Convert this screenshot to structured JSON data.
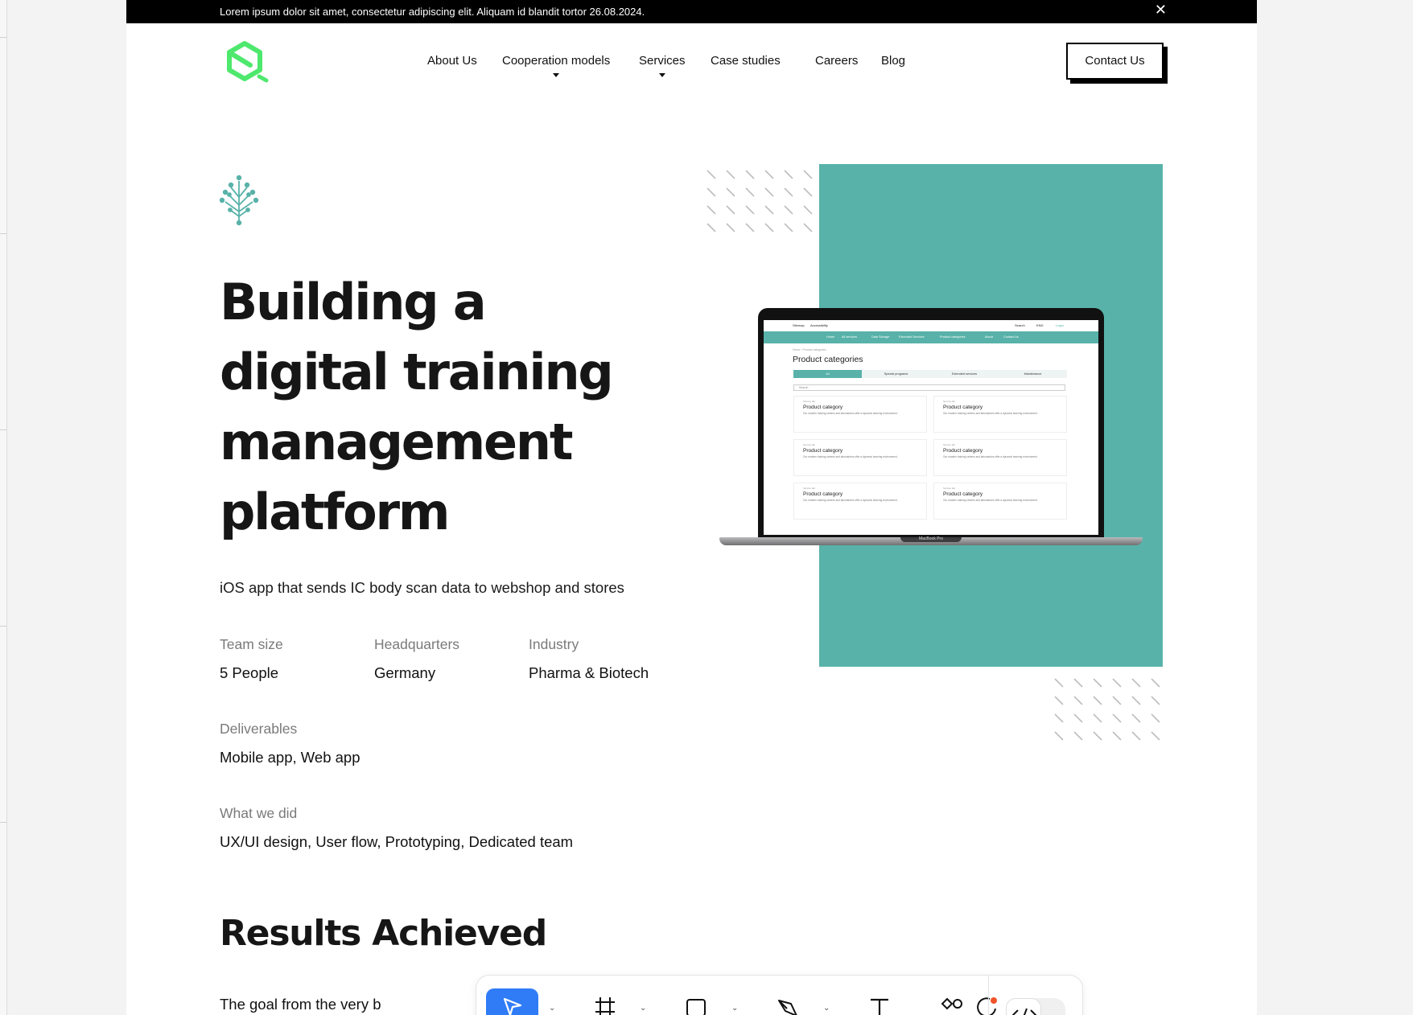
{
  "announcement": {
    "text": "Lorem ipsum dolor sit amet, consectetur adipiscing elit. Aliquam id blandit tortor 26.08.2024.",
    "close": "✕"
  },
  "nav": {
    "items": [
      {
        "label": "About Us",
        "dropdown": false
      },
      {
        "label": "Cooperation models",
        "dropdown": true
      },
      {
        "label": "Services",
        "dropdown": true
      },
      {
        "label": "Case studies",
        "dropdown": false
      },
      {
        "label": "Careers",
        "dropdown": false
      },
      {
        "label": "Blog",
        "dropdown": false
      }
    ],
    "cta": "Contact Us"
  },
  "hero": {
    "title_lines": [
      "Building a",
      "digital training",
      "management",
      "platform"
    ],
    "subtitle": "iOS app that sends IC body scan data to webshop and stores"
  },
  "facts": {
    "team_size": {
      "label": "Team size",
      "value": "5 People"
    },
    "headquarters": {
      "label": "Headquarters",
      "value": "Germany"
    },
    "industry": {
      "label": "Industry",
      "value": "Pharma & Biotech"
    },
    "deliverables": {
      "label": "Deliverables",
      "value": "Mobile app, Web app"
    },
    "what_we_did": {
      "label": "What we did",
      "value": "UX/UI design, User flow, Prototyping, Dedicated team"
    }
  },
  "results": {
    "heading": "Results Achieved",
    "text": "The goal from the very b"
  },
  "mockup": {
    "sitemap": "Sitemap",
    "accessibility": "Accessibility",
    "search": "Search",
    "lang": "ENG",
    "login": "Login",
    "nav_items": [
      "Home",
      "All services",
      "Data Storage",
      "Extended Services",
      "Product categories",
      "About",
      "Contact Us"
    ],
    "breadcrumb": "Home › Product categories",
    "page_title": "Product categories",
    "tabs": [
      "All",
      "Special programs",
      "Extended services",
      "Maintenance"
    ],
    "search_placeholder": "Search",
    "cards": [
      {
        "tag": "Service tab",
        "title": "Product category",
        "desc": "Our modern training centers and laboratories offer a dynamic learning environment."
      },
      {
        "tag": "Service tab",
        "title": "Product category",
        "desc": "Our modern training centers and laboratories offer a dynamic learning environment."
      },
      {
        "tag": "Service tab",
        "title": "Product category",
        "desc": "Our modern training centers and laboratories offer a dynamic learning environment."
      },
      {
        "tag": "Service tab",
        "title": "Product category",
        "desc": "Our modern training centers and laboratories offer a dynamic learning environment."
      },
      {
        "tag": "Service tab",
        "title": "Product category",
        "desc": "Our modern training centers and laboratories offer a dynamic learning environment."
      },
      {
        "tag": "Service tab",
        "title": "Product category",
        "desc": "Our modern training centers and laboratories offer a dynamic learning environment."
      }
    ],
    "device_label": "MacBook Pro"
  },
  "toolbar": {
    "tools": [
      "move-icon",
      "frame-icon",
      "rectangle-icon",
      "pen-icon",
      "text-icon",
      "comment-icon",
      "shapes-icon"
    ],
    "code_toggle_icon": "code-icon"
  },
  "colors": {
    "accent_teal": "#58b2a9",
    "logo_green": "#4ee86d",
    "announcement_bg": "#000000",
    "tool_active": "#2f7cf6"
  }
}
